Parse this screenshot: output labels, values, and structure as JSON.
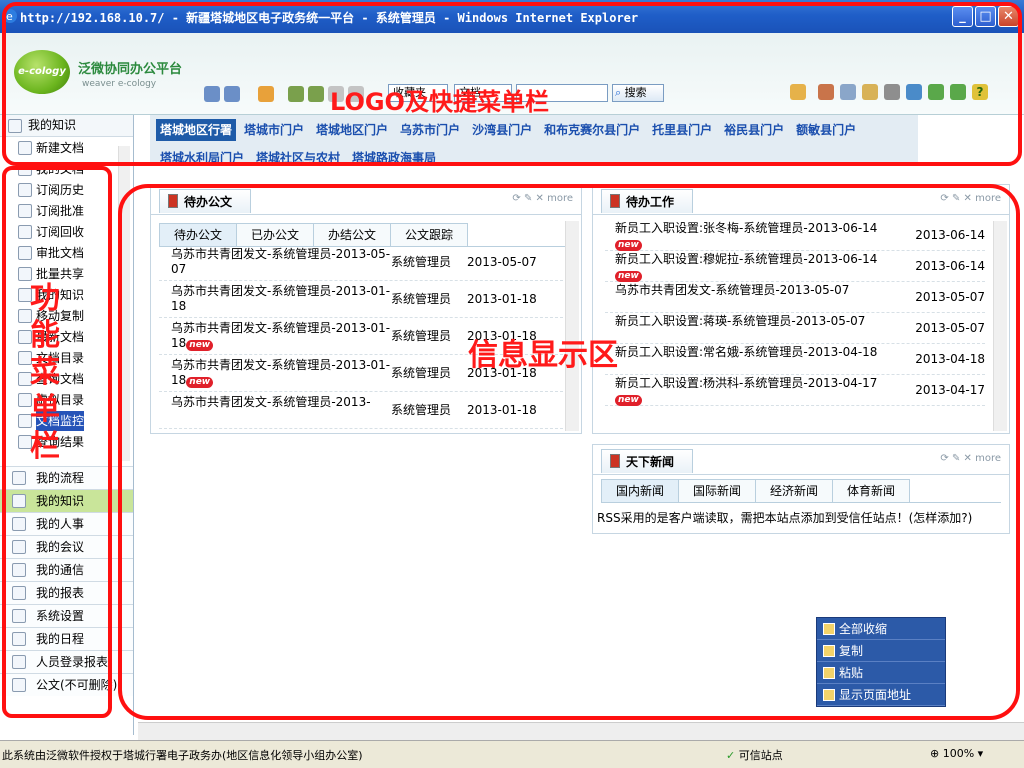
{
  "window": {
    "title": "http://192.168.10.7/ - 新疆塔城地区电子政务统一平台 - 系统管理员 - Windows Internet Explorer"
  },
  "header": {
    "logo_text": "e-cology",
    "brand": "泛微协同办公平台",
    "brand_sub": "weaver e-cology",
    "combo1": "收藏夹",
    "combo2": "文档",
    "search_label": "搜索"
  },
  "annotations": {
    "logo_bar": "LOGO及快捷菜单栏",
    "func_menu": "功能菜单栏",
    "info_area": "信息显示区"
  },
  "portals": {
    "row1": [
      "塔城地区行署",
      "塔城市门户",
      "塔城地区门户",
      "乌苏市门户",
      "沙湾县门户",
      "和布克赛尔县门户",
      "托里县门户",
      "裕民县门户",
      "额敏县门户"
    ],
    "row2": [
      "塔城水利局门户",
      "塔城社区与农村",
      "塔城路政海事局"
    ]
  },
  "sidebar": {
    "section_title": "我的知识",
    "sub_items": [
      "新建文档",
      "我的文档",
      "订阅历史",
      "订阅批准",
      "订阅回收",
      "审批文档",
      "批量共享",
      "我的知识",
      "移动复制",
      "最新文档",
      "文档目录",
      "查询文档",
      "虚拟目录",
      "文档监控",
      "查询结果"
    ],
    "selected_sub": "文档监控",
    "main_items": [
      "我的流程",
      "我的知识",
      "我的人事",
      "我的会议",
      "我的通信",
      "我的报表",
      "系统设置",
      "我的日程",
      "人员登录报表",
      "公文(不可删除)"
    ],
    "active_main": "我的知识"
  },
  "pending_docs": {
    "title": "待办公文",
    "more": "more",
    "tabs": [
      "待办公文",
      "已办公文",
      "办结公文",
      "公文跟踪"
    ],
    "rows": [
      {
        "title": "乌苏市共青团发文-系统管理员-2013-05-07",
        "user": "系统管理员",
        "date": "2013-05-07",
        "new": false
      },
      {
        "title": "乌苏市共青团发文-系统管理员-2013-01-18",
        "user": "系统管理员",
        "date": "2013-01-18",
        "new": false
      },
      {
        "title": "乌苏市共青团发文-系统管理员-2013-01-18",
        "user": "系统管理员",
        "date": "2013-01-18",
        "new": true
      },
      {
        "title": "乌苏市共青团发文-系统管理员-2013-01-18",
        "user": "系统管理员",
        "date": "2013-01-18",
        "new": true
      },
      {
        "title": "乌苏市共青团发文-系统管理员-2013-",
        "user": "系统管理员",
        "date": "2013-01-18",
        "new": false
      }
    ]
  },
  "pending_work": {
    "title": "待办工作",
    "more": "more",
    "rows": [
      {
        "title": "新员工入职设置:张冬梅-系统管理员-2013-06-14",
        "date": "2013-06-14",
        "new": true
      },
      {
        "title": "新员工入职设置:穆妮拉-系统管理员-2013-06-14",
        "date": "2013-06-14",
        "new": true
      },
      {
        "title": "乌苏市共青团发文-系统管理员-2013-05-07",
        "date": "2013-05-07",
        "new": false
      },
      {
        "title": "新员工入职设置:蒋瑛-系统管理员-2013-05-07",
        "date": "2013-05-07",
        "new": false
      },
      {
        "title": "新员工入职设置:常名娥-系统管理员-2013-04-18",
        "date": "2013-04-18",
        "new": false
      },
      {
        "title": "新员工入职设置:杨洪科-系统管理员-2013-04-17",
        "date": "2013-04-17",
        "new": true
      }
    ]
  },
  "news": {
    "title": "天下新闻",
    "more": "more",
    "tabs": [
      "国内新闻",
      "国际新闻",
      "经济新闻",
      "体育新闻"
    ],
    "message": "RSS采用的是客户端读取，需把本站点添加到受信任站点！(怎样添加?)"
  },
  "context_menu": {
    "items": [
      "全部收缩",
      "复制",
      "粘贴",
      "显示页面地址"
    ]
  },
  "statusbar": {
    "text": "此系统由泛微软件授权于塔城行署电子政务办(地区信息化领导小组办公室)",
    "trusted": "可信站点",
    "zoom": "100%"
  },
  "new_badge": "new",
  "colors": {
    "accent": "#1e5ba8",
    "annotation": "#ff1010"
  }
}
